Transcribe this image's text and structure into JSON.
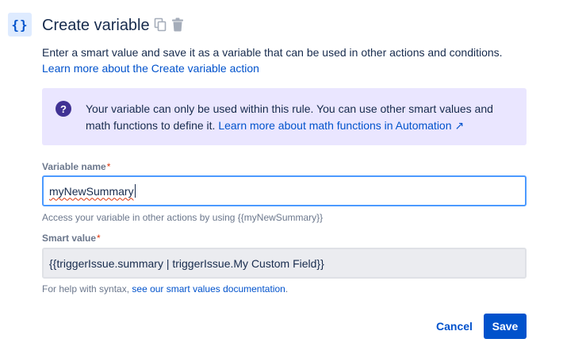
{
  "header": {
    "icon_glyph": "{}",
    "title": "Create variable",
    "copy_icon": "copy-icon",
    "delete_icon": "trash-icon"
  },
  "description": {
    "text": "Enter a smart value and save it as a variable that can be used in other actions and conditions.",
    "link": "Learn more about the Create variable action"
  },
  "info_panel": {
    "icon_glyph": "?",
    "text": "Your variable can only be used within this rule. You can use other smart values and math functions to define it.",
    "link": "Learn more about math functions in Automation ↗"
  },
  "variable_name": {
    "label": "Variable name",
    "required_mark": "*",
    "value": "myNewSummary",
    "helper": "Access your variable in other actions by using {{myNewSummary}}"
  },
  "smart_value": {
    "label": "Smart value",
    "required_mark": "*",
    "value": "{{triggerIssue.summary | triggerIssue.My Custom Field}}",
    "helper_prefix": "For help with syntax,",
    "helper_link": "see our smart values documentation",
    "helper_suffix": "."
  },
  "buttons": {
    "cancel": "Cancel",
    "save": "Save"
  },
  "colors": {
    "primary": "#0052cc",
    "info_bg": "#eae6ff",
    "info_icon": "#403294",
    "focus_border": "#4c9aff",
    "required": "#de350b"
  }
}
